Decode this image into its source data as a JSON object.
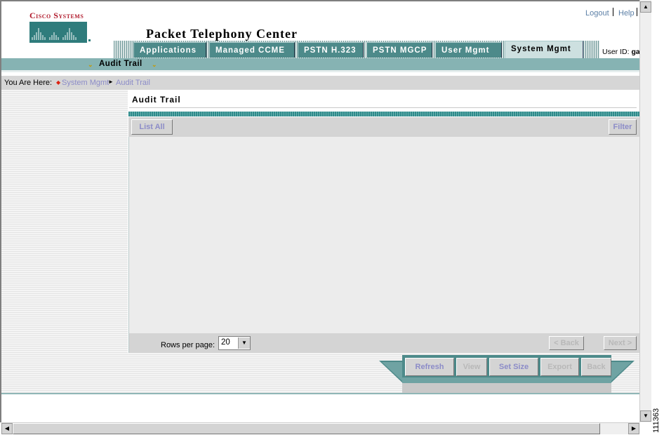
{
  "brand": {
    "logo_text": "Cisco Systems",
    "app_title": "Packet Telephony Center"
  },
  "top_links": {
    "logout": "Logout",
    "help": "Help"
  },
  "tabs": [
    {
      "label": "Applications"
    },
    {
      "label": "Managed CCME"
    },
    {
      "label": "PSTN H.323"
    },
    {
      "label": "PSTN MGCP"
    },
    {
      "label": "User Mgmt"
    },
    {
      "label": "System Mgmt",
      "active": true
    }
  ],
  "user": {
    "label": "User ID:",
    "value": "ga"
  },
  "subnav": {
    "label": "Audit Trail"
  },
  "breadcrumb": {
    "prefix": "You Are Here:",
    "items": [
      "System Mgmt",
      "Audit Trail"
    ]
  },
  "content": {
    "title": "Audit Trail"
  },
  "toolbar": {
    "list_all": "List All",
    "filter": "Filter"
  },
  "pager": {
    "rows_label": "Rows per page:",
    "rows_value": "20",
    "back": "< Back",
    "next": "Next >"
  },
  "actions": {
    "refresh": "Refresh",
    "view": "View",
    "set_size": "Set Size",
    "export": "Export",
    "back": "Back"
  },
  "figure_id": "111363",
  "colors": {
    "teal": "#4d8a8a",
    "link": "#8c8cc8",
    "logo_red": "#b0182a"
  }
}
